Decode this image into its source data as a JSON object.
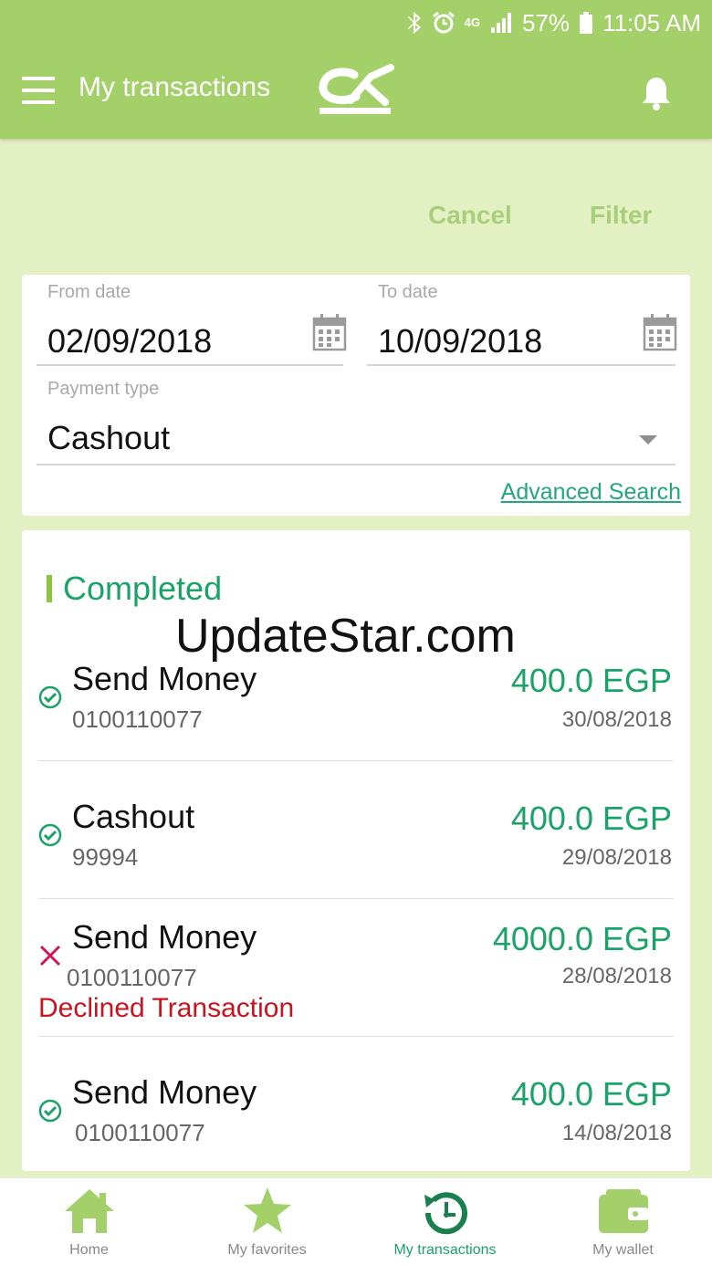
{
  "status_bar": {
    "network": "4G",
    "battery": "57%",
    "time": "11:05 AM"
  },
  "app_bar": {
    "title": "My transactions"
  },
  "actions": {
    "cancel": "Cancel",
    "filter": "Filter"
  },
  "filters": {
    "from_label": "From date",
    "from_value": "02/09/2018",
    "to_label": "To date",
    "to_value": "10/09/2018",
    "payment_label": "Payment type",
    "payment_value": "Cashout",
    "advanced_search": "Advanced Search"
  },
  "section_title": "Completed",
  "watermark": "UpdateStar.com",
  "transactions": [
    {
      "status": "completed",
      "title": "Send Money",
      "ref": "0100110077",
      "amount": "400.0 EGP",
      "date": "30/08/2018"
    },
    {
      "status": "completed",
      "title": "Cashout",
      "ref": "99994",
      "amount": "400.0 EGP",
      "date": "29/08/2018"
    },
    {
      "status": "declined",
      "title": "Send Money",
      "ref": "0100110077",
      "amount": "4000.0 EGP",
      "date": "28/08/2018",
      "note": "Declined Transaction"
    },
    {
      "status": "completed",
      "title": "Send Money",
      "ref": "0100110077",
      "amount": "400.0 EGP",
      "date": "14/08/2018"
    }
  ],
  "nav": [
    {
      "label": "Home",
      "icon": "home-icon"
    },
    {
      "label": "My favorites",
      "icon": "star-icon"
    },
    {
      "label": "My transactions",
      "icon": "history-icon",
      "active": true
    },
    {
      "label": "My wallet",
      "icon": "wallet-icon"
    }
  ],
  "colors": {
    "primary_green": "#a4d06a",
    "accent_green": "#1aa368",
    "declined_red": "#c8141e"
  }
}
